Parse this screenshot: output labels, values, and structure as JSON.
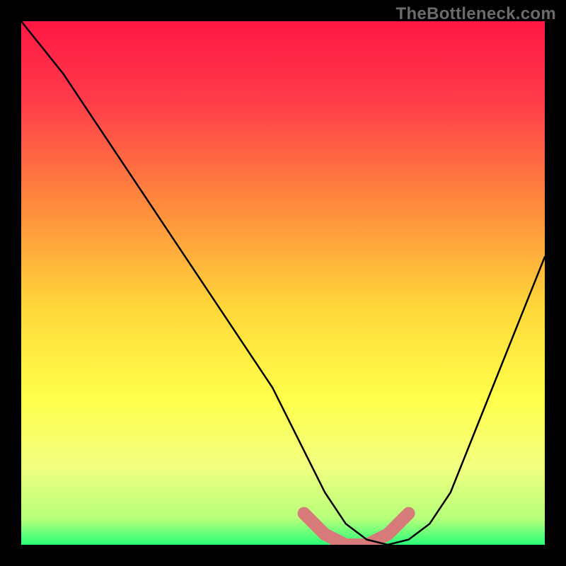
{
  "watermark": "TheBottleneck.com",
  "chart_data": {
    "type": "line",
    "title": "",
    "xlabel": "",
    "ylabel": "",
    "xlim": [
      0,
      100
    ],
    "ylim": [
      0,
      100
    ],
    "grid": false,
    "legend": false,
    "background_gradient": {
      "stops": [
        {
          "pos": 0.0,
          "color": "#ff1744"
        },
        {
          "pos": 0.15,
          "color": "#ff3b4a"
        },
        {
          "pos": 0.35,
          "color": "#ff8a3d"
        },
        {
          "pos": 0.55,
          "color": "#ffd83a"
        },
        {
          "pos": 0.72,
          "color": "#ffff4a"
        },
        {
          "pos": 0.85,
          "color": "#f2ff80"
        },
        {
          "pos": 0.95,
          "color": "#b6ff7a"
        },
        {
          "pos": 1.0,
          "color": "#2bff79"
        }
      ]
    },
    "series": [
      {
        "name": "bottleneck-curve",
        "stroke": "#000000",
        "x": [
          0,
          8,
          16,
          24,
          32,
          40,
          48,
          54,
          58,
          62,
          66,
          70,
          74,
          78,
          82,
          86,
          92,
          100
        ],
        "y": [
          100,
          90,
          78,
          66,
          54,
          42,
          30,
          18,
          10,
          4,
          1,
          0,
          1,
          4,
          10,
          20,
          35,
          55
        ]
      }
    ],
    "highlight": {
      "name": "bottom-band",
      "stroke": "#d67a7a",
      "thickness": 18,
      "x": [
        54,
        58,
        62,
        66,
        70,
        74
      ],
      "y": [
        6,
        2,
        0,
        0,
        2,
        6
      ]
    }
  }
}
